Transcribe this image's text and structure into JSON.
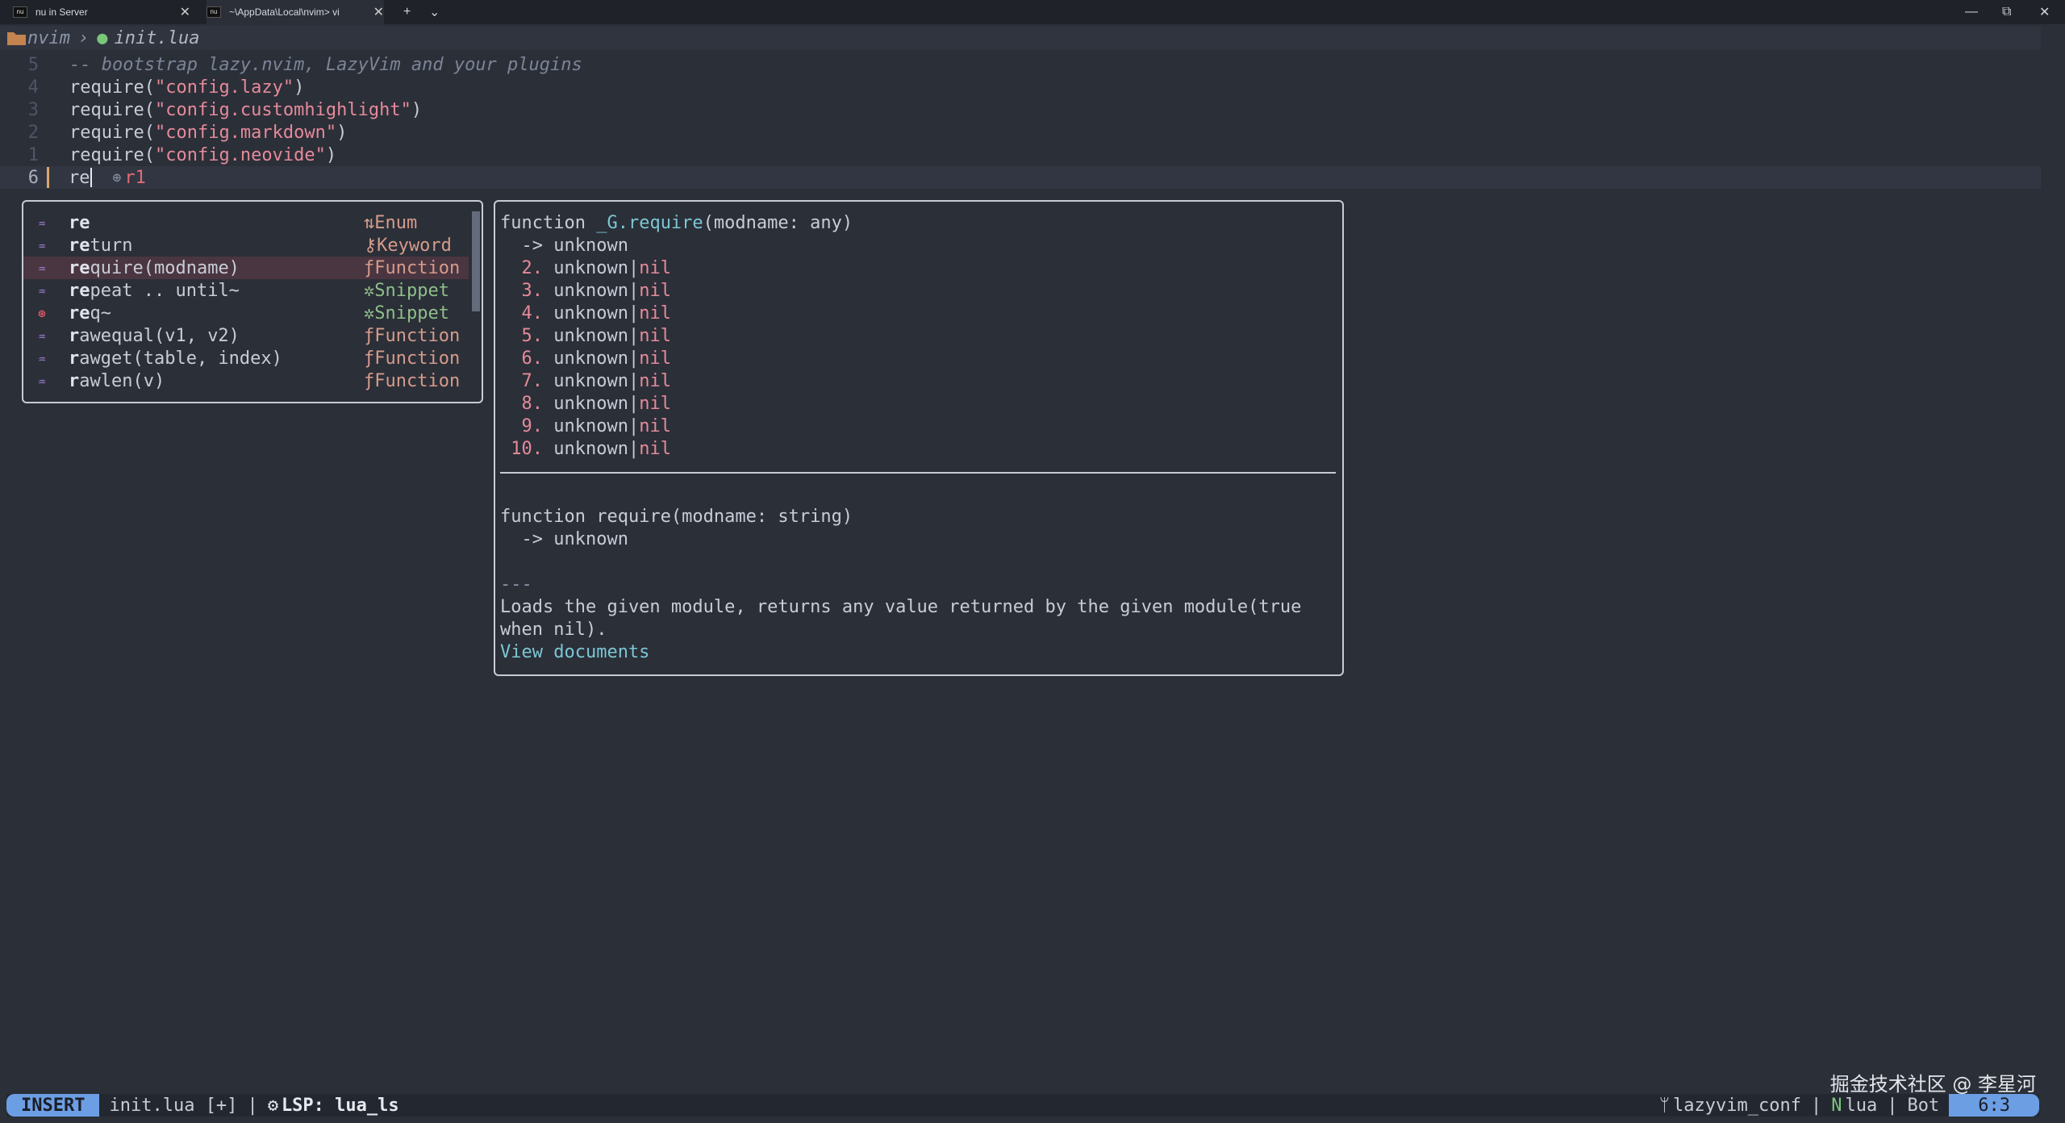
{
  "tabs": [
    {
      "label": "nu in Server",
      "close": "✕"
    },
    {
      "label": "~\\AppData\\Local\\nvim> vi",
      "close": "✕"
    }
  ],
  "titlebar": {
    "new_tab": "+",
    "dropdown": "⌄",
    "minimize": "—",
    "restore": "⧉",
    "close": "✕"
  },
  "winbar": {
    "folder": "nvim",
    "separator": "›",
    "file": "init.lua"
  },
  "lines": [
    {
      "num": "5",
      "text": "-- bootstrap lazy.nvim, LazyVim and your plugins"
    },
    {
      "num": "4",
      "fn": "require(",
      "str": "\"config.lazy\"",
      "close": ")"
    },
    {
      "num": "3",
      "fn": "require(",
      "str": "\"config.customhighlight\"",
      "close": ")"
    },
    {
      "num": "2",
      "fn": "require(",
      "str": "\"config.markdown\"",
      "close": ")"
    },
    {
      "num": "1",
      "fn": "require(",
      "str": "\"config.neovide\"",
      "close": ")"
    },
    {
      "num": "6",
      "text": "re",
      "diag": "r1"
    }
  ],
  "completion": [
    {
      "match": "re",
      "rest": "",
      "kind_icon": "⇅",
      "kind": "Enum"
    },
    {
      "match": "re",
      "rest": "turn",
      "kind_icon": "⚷",
      "kind": "Keyword"
    },
    {
      "match": "re",
      "rest": "quire(modname)",
      "kind_icon": "ƒ",
      "kind": "Function"
    },
    {
      "match": "re",
      "rest": "peat .. until~",
      "kind_icon": "✲",
      "kind": "Snippet"
    },
    {
      "match": "re",
      "rest": "q~",
      "kind_icon": "✲",
      "kind": "Snippet"
    },
    {
      "match": "r",
      "rest": "awequal(v1, v2)",
      "kind_icon": "ƒ",
      "kind": "Function"
    },
    {
      "match": "r",
      "rest": "awget(table, index)",
      "kind_icon": "ƒ",
      "kind": "Function"
    },
    {
      "match": "r",
      "rest": "awlen(v)",
      "kind_icon": "ƒ",
      "kind": "Function"
    }
  ],
  "doc": {
    "sig1_a": "function ",
    "sig1_b": "_G.require",
    "sig1_c": "(modname: any)",
    "ret1": "  -> unknown",
    "returns": [
      {
        "idx": "  2.",
        "val": "unknown|nil"
      },
      {
        "idx": "  3.",
        "val": "unknown|nil"
      },
      {
        "idx": "  4.",
        "val": "unknown|nil"
      },
      {
        "idx": "  5.",
        "val": "unknown|nil"
      },
      {
        "idx": "  6.",
        "val": "unknown|nil"
      },
      {
        "idx": "  7.",
        "val": "unknown|nil"
      },
      {
        "idx": "  8.",
        "val": "unknown|nil"
      },
      {
        "idx": "  9.",
        "val": "unknown|nil"
      },
      {
        "idx": " 10.",
        "val": "unknown|nil"
      }
    ],
    "sig2": "function require(modname: string)",
    "ret2": "  -> unknown",
    "sep": "---",
    "desc1": "Loads the given module, returns any value returned by the given module(true",
    "desc2": "when nil).",
    "link": "View documents"
  },
  "status": {
    "mode": "INSERT",
    "file": "init.lua [+]",
    "sep": "|",
    "lsp": "LSP: lua_ls",
    "branch": "lazyvim_conf",
    "ft": "lua",
    "scroll": "Bot",
    "pos": "6:3"
  },
  "watermark": "掘金技术社区 @ 李星河"
}
